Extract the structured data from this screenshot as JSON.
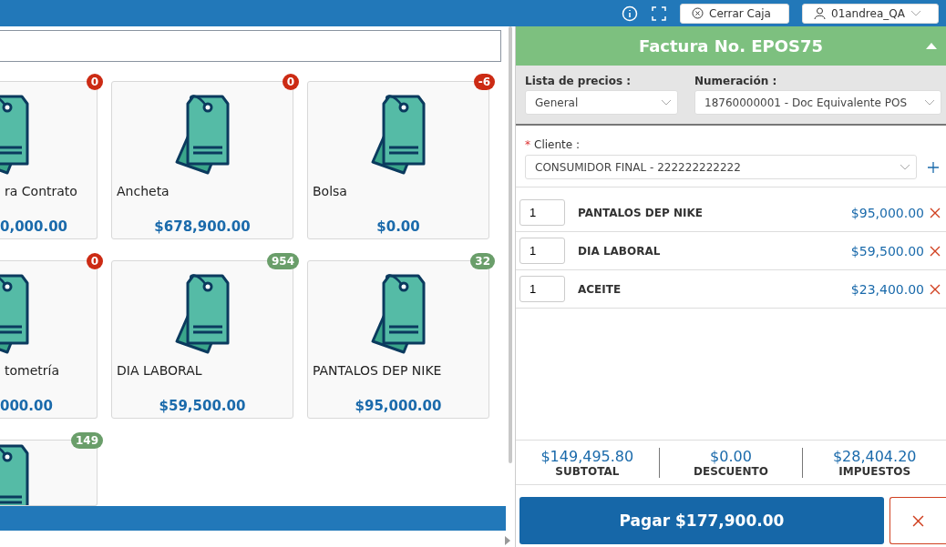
{
  "header": {
    "buttons": [
      {
        "kind": "close-circle",
        "label": "Cerrar Caja"
      },
      {
        "kind": "user",
        "label": "01andrea_QA"
      }
    ]
  },
  "products": [
    {
      "name": "ra Contrato",
      "price": "0,000.00",
      "stock": "0",
      "color": "#cc2b14"
    },
    {
      "name": "Ancheta",
      "price": "$678,900.00",
      "stock": "0",
      "color": "#cc2b14"
    },
    {
      "name": "Bolsa",
      "price": "$0.00",
      "stock": "-6",
      "color": "#cc2b14"
    },
    {
      "name": "tometría",
      "price": "000.00",
      "stock": "0",
      "color": "#cc2b14"
    },
    {
      "name": "DIA LABORAL",
      "price": "$59,500.00",
      "stock": "954",
      "color": "#6a9e6a"
    },
    {
      "name": "PANTALOS DEP NIKE",
      "price": "$95,000.00",
      "stock": "32",
      "color": "#6a9e6a"
    },
    {
      "stock": "149",
      "color": "#6a9e6a"
    }
  ],
  "invoice": {
    "title": "Factura No. EPOS75",
    "expanded": true,
    "price_list": {
      "label": "Lista de precios :",
      "value": "General"
    },
    "numbering": {
      "label": "Numeración :",
      "value": "18760000001 - Doc Equivalente POS"
    },
    "client": {
      "required_mark": "*",
      "label": "Cliente :",
      "value": "CONSUMIDOR FINAL - 222222222222"
    },
    "items": [
      {
        "qty": "1",
        "name": "PANTALOS DEP NIKE",
        "price": "$95,000.00"
      },
      {
        "qty": "1",
        "name": "DIA LABORAL",
        "price": "$59,500.00"
      },
      {
        "qty": "1",
        "name": "ACEITE",
        "price": "$23,400.00"
      }
    ],
    "totals": [
      {
        "value": "$149,495.80",
        "label": "SUBTOTAL"
      },
      {
        "value": "$0.00",
        "label": "DESCUENTO"
      },
      {
        "value": "$28,404.20",
        "label": "IMPUESTOS"
      }
    ],
    "pay_button": "Pagar $177,900.00"
  }
}
